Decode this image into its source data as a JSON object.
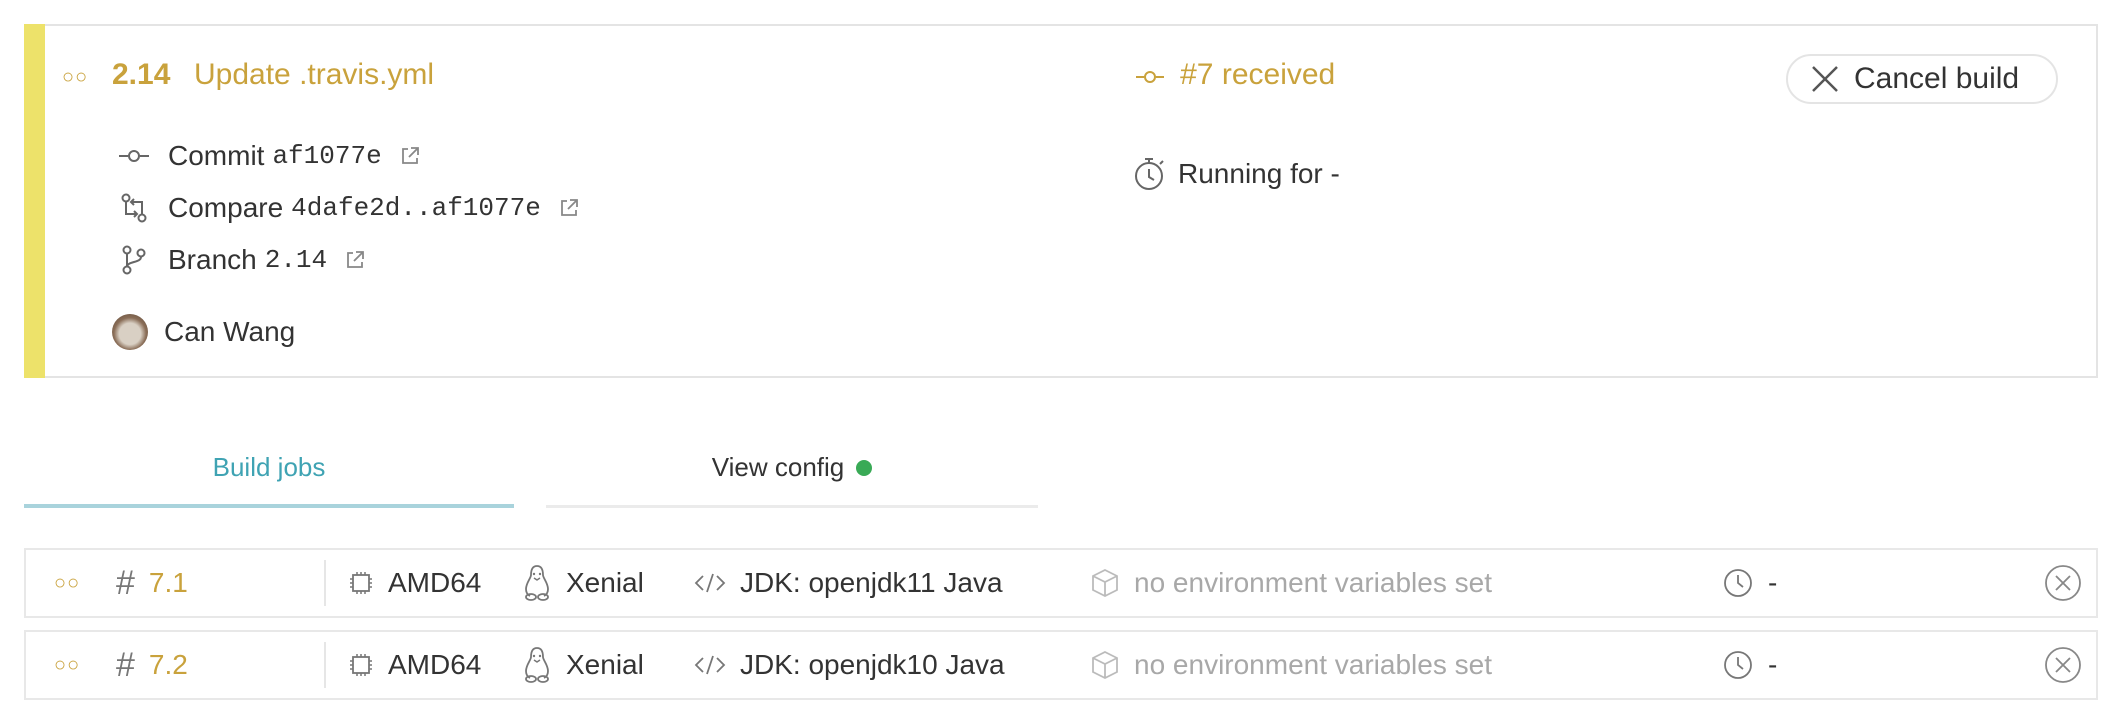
{
  "build": {
    "status_dots": "○○",
    "number": "2.14",
    "message": "Update .travis.yml",
    "received": "#7 received",
    "cancel_label": "Cancel build",
    "commit_label": "Commit",
    "commit_sha": "af1077e",
    "compare_label": "Compare",
    "compare_range": "4dafe2d..af1077e",
    "branch_label": "Branch",
    "branch_name": "2.14",
    "running_label": "Running for -",
    "author": "Can Wang",
    "status_color": "#c9a23c",
    "stripe_color": "#ede26a"
  },
  "tabs": [
    {
      "label": "Build jobs",
      "active": true
    },
    {
      "label": "View config",
      "status_dot_color": "#39aa56"
    }
  ],
  "jobs": [
    {
      "status_dots": "○○",
      "hash": "#",
      "number": "7.1",
      "arch": "AMD64",
      "os": "Xenial",
      "language": "JDK: openjdk11 Java",
      "env": "no environment variables set",
      "duration": "-"
    },
    {
      "status_dots": "○○",
      "hash": "#",
      "number": "7.2",
      "arch": "AMD64",
      "os": "Xenial",
      "language": "JDK: openjdk10 Java",
      "env": "no environment variables set",
      "duration": "-"
    }
  ]
}
